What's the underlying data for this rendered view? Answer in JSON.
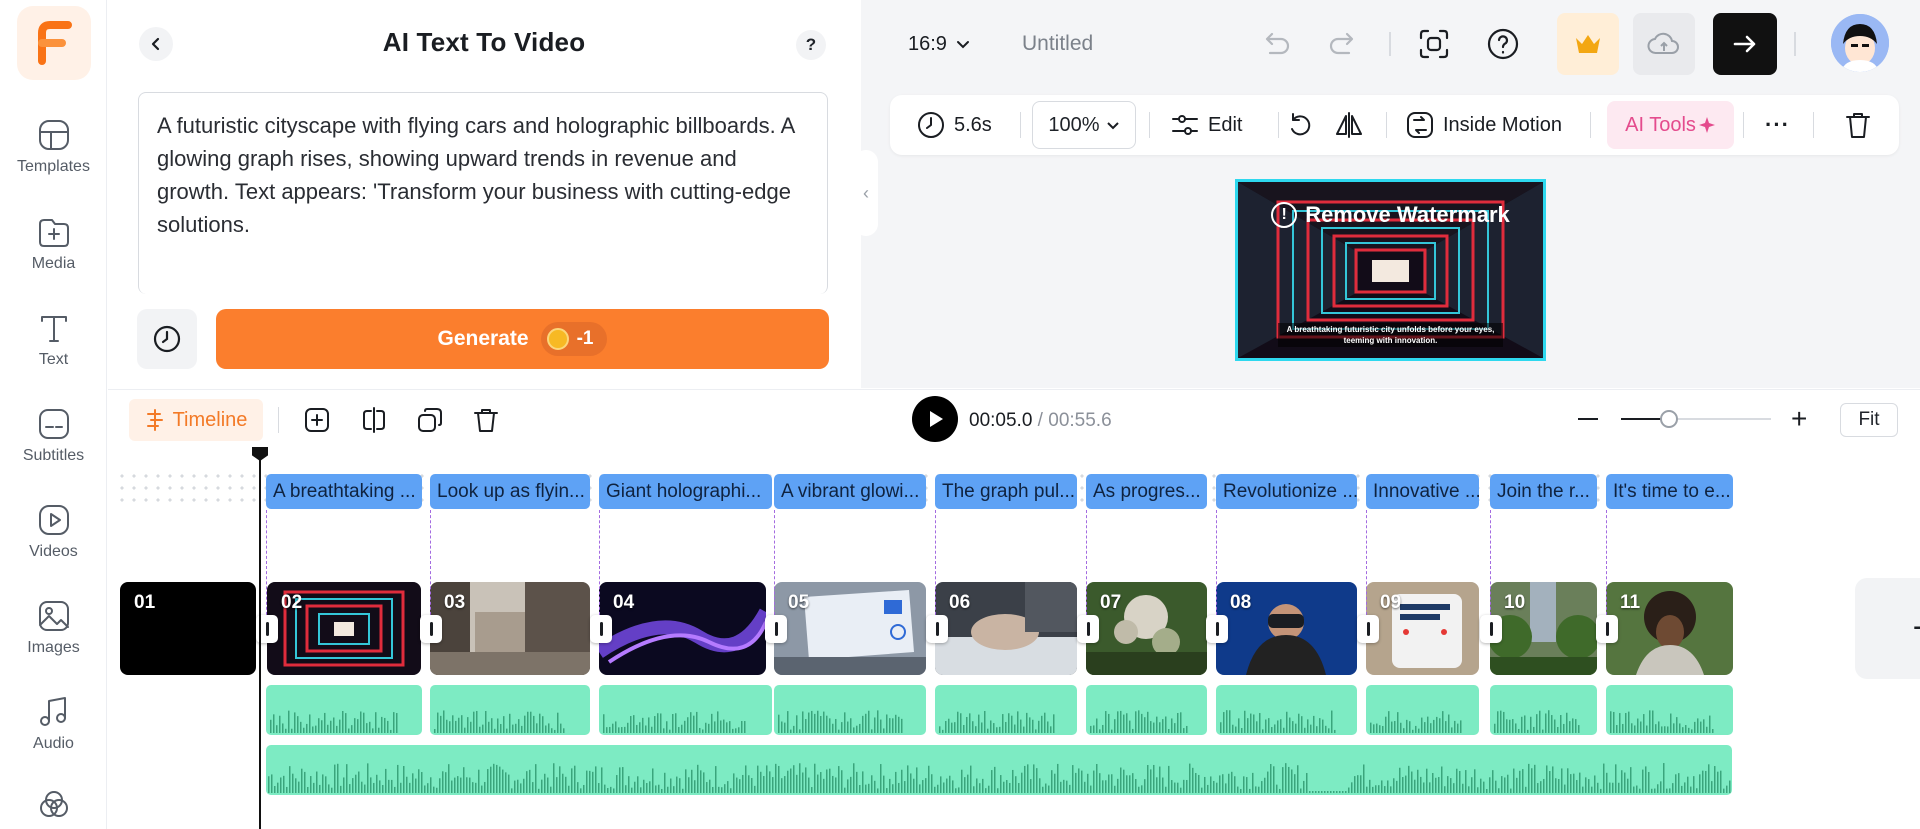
{
  "sidebar": {
    "logo": "F",
    "items": [
      {
        "label": "Templates",
        "icon": "templates-icon"
      },
      {
        "label": "Media",
        "icon": "media-icon"
      },
      {
        "label": "Text",
        "icon": "text-icon"
      },
      {
        "label": "Subtitles",
        "icon": "subtitles-icon"
      },
      {
        "label": "Videos",
        "icon": "videos-icon"
      },
      {
        "label": "Images",
        "icon": "images-icon"
      },
      {
        "label": "Audio",
        "icon": "audio-icon"
      }
    ]
  },
  "panel": {
    "title": "AI Text To Video",
    "help": "?",
    "prompt": "A futuristic cityscape with flying cars and holographic billboards. A glowing graph rises, showing upward trends in revenue and growth. Text appears: 'Transform your business with cutting-edge solutions.",
    "generate_label": "Generate",
    "credit": "-1"
  },
  "topbar": {
    "ratio": "16:9",
    "project_title": "Untitled"
  },
  "toolbar": {
    "duration": "5.6s",
    "zoom": "100%",
    "edit": "Edit",
    "inside_motion": "Inside Motion",
    "ai_tools": "AI Tools",
    "more": "···"
  },
  "preview": {
    "watermark": "Remove Watermark",
    "caption": "A breathtaking futuristic city unfolds before your eyes, teeming with innovation."
  },
  "timeline": {
    "tab_label": "Timeline",
    "current_time": "00:05.0",
    "separator": " / ",
    "total_time": "00:55.6",
    "zoom_level": 0.32,
    "fit_label": "Fit",
    "subtitles": [
      "A breathtaking ...",
      "Look up as flyin...",
      "Giant holographi...",
      "A vibrant glowi...",
      "The graph pul...",
      "As progres...",
      "Revolutionize ...",
      "Innovative ...",
      "Join the r...",
      "It's time to e..."
    ],
    "clips": [
      "01",
      "02",
      "03",
      "04",
      "05",
      "06",
      "07",
      "08",
      "09",
      "10",
      "11"
    ],
    "add_label": "+"
  },
  "colors": {
    "accent": "#fb7e2d",
    "subtitle": "#5ea2f5",
    "audio": "#7debc3",
    "preview_border": "#2ed8ee"
  }
}
